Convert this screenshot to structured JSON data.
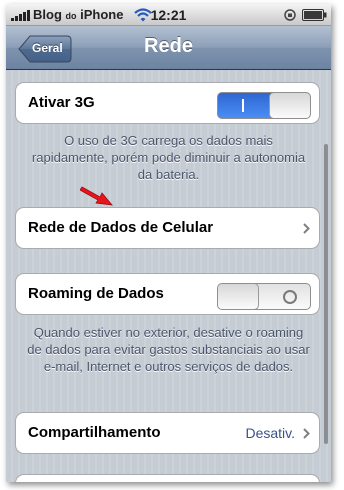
{
  "status_bar": {
    "carrier_prefix": "Blog",
    "carrier_small": "do",
    "carrier_suffix": "iPhone",
    "time": "12:21",
    "icons": [
      "signal-bars-icon",
      "wifi-icon",
      "orientation-lock-icon",
      "battery-icon"
    ]
  },
  "nav": {
    "back_label": "Geral",
    "title": "Rede"
  },
  "settings": {
    "enable_3g": {
      "label": "Ativar 3G",
      "on": true,
      "note": "O uso de 3G carrega os dados mais rapidamente, porém pode diminuir a autonomia da bateria."
    },
    "cellular_data_network": {
      "label": "Rede de Dados de Celular"
    },
    "data_roaming": {
      "label": "Roaming de Dados",
      "on": false,
      "note": "Quando estiver no exterior, desative o roaming de dados para evitar gastos substanciais ao usar e-mail, Internet e outros serviços de dados."
    },
    "tethering": {
      "label": "Compartilhamento",
      "value": "Desativ."
    }
  },
  "colors": {
    "navbar": "#6c84a2",
    "value_text": "#385487",
    "switch_on": "#2f66d1",
    "background": "#c5ccd4",
    "annotation_arrow": "#e8141c"
  }
}
